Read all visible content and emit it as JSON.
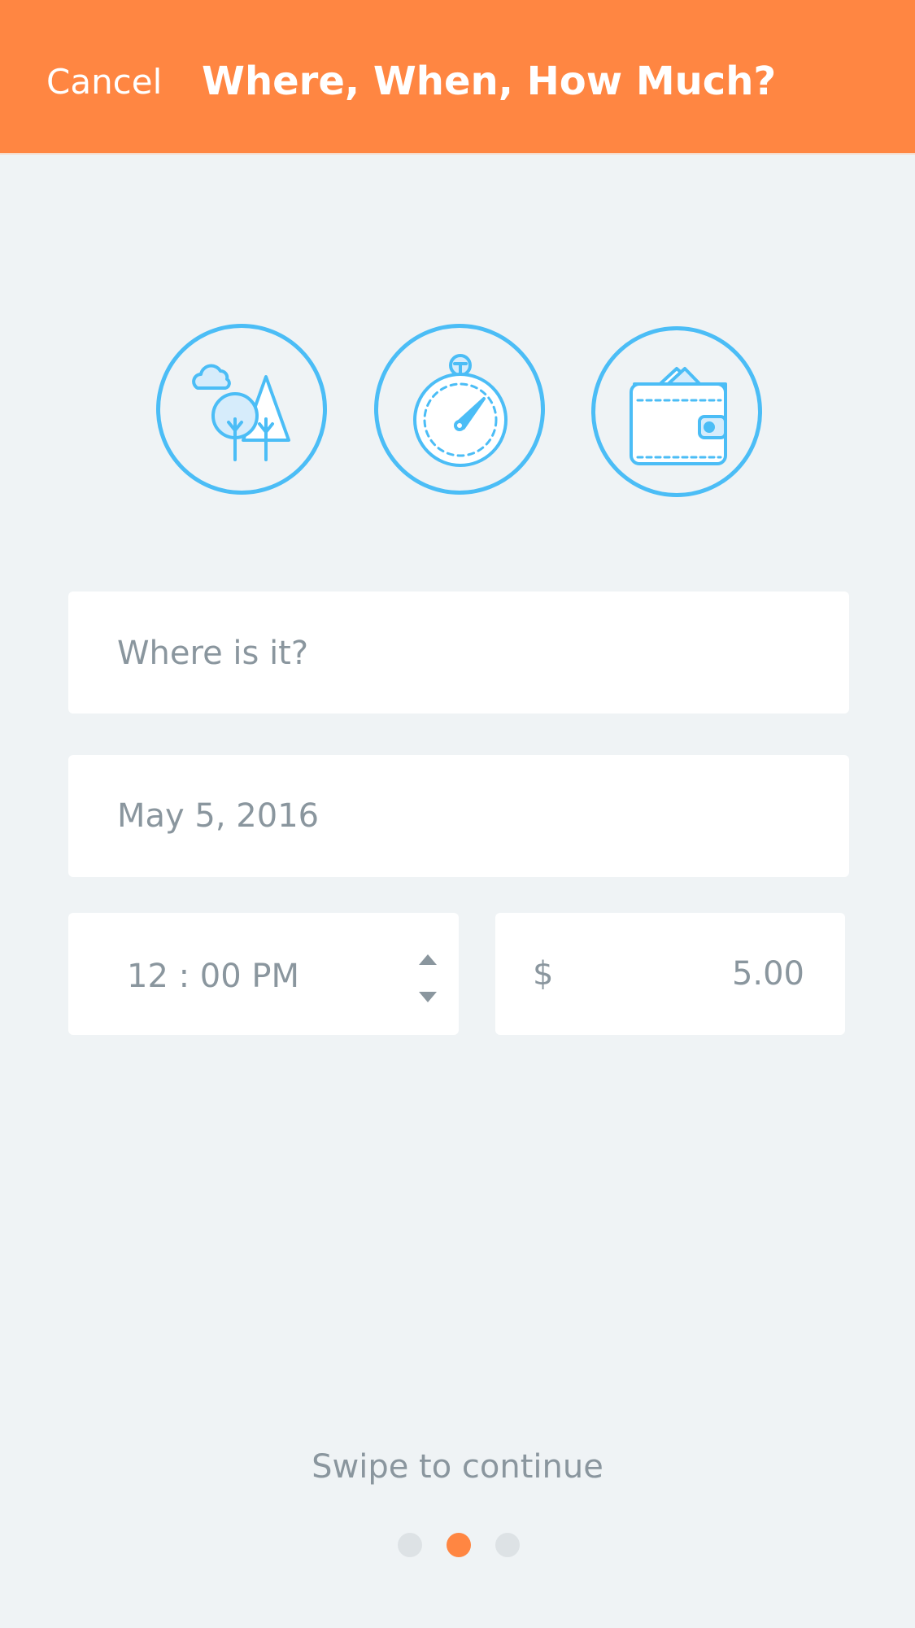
{
  "header": {
    "cancel_label": "Cancel",
    "title": "Where, When, How Much?",
    "background_color": "#ff8642"
  },
  "icons": [
    {
      "name": "park-icon"
    },
    {
      "name": "stopwatch-icon"
    },
    {
      "name": "wallet-icon"
    }
  ],
  "form": {
    "location": {
      "value": "",
      "placeholder": "Where is it?"
    },
    "date": {
      "value": "May 5, 2016"
    },
    "time": {
      "value": "12 : 00 PM"
    },
    "price": {
      "currency_symbol": "$",
      "value": "5.00"
    }
  },
  "footer": {
    "swipe_text": "Swipe to continue",
    "page_count": 3,
    "active_page": 2
  },
  "colors": {
    "accent": "#ff8642",
    "icon": "#4bbdf6",
    "muted_text": "#8a969e",
    "dot_inactive": "#dde2e5",
    "background": "#eff3f5"
  }
}
